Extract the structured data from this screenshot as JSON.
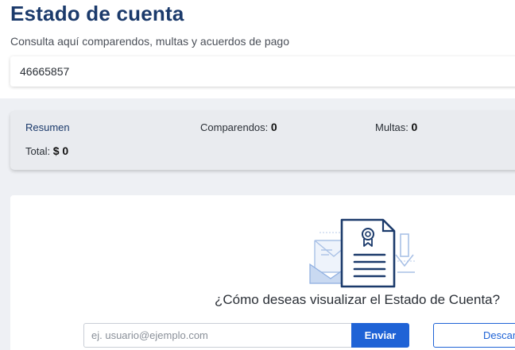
{
  "header": {
    "title": "Estado de cuenta",
    "subtitle": "Consulta aquí comparendos, multas y acuerdos de pago",
    "search_value": "46665857"
  },
  "summary": {
    "tab_label": "Resumen",
    "comparendos_label": "Comparendos:",
    "comparendos_value": "0",
    "multas_label": "Multas:",
    "multas_value": "0",
    "total_label": "Total:",
    "total_value": "$ 0"
  },
  "visualize": {
    "icon": "certificate-document-icon",
    "question": "¿Cómo deseas visualizar el Estado de Cuenta?",
    "email_placeholder": "ej. usuario@ejemplo.com",
    "send_label": "Enviar",
    "download_label": "Descar"
  },
  "colors": {
    "brand": "#1b3a6b",
    "accent": "#1f63d6"
  }
}
